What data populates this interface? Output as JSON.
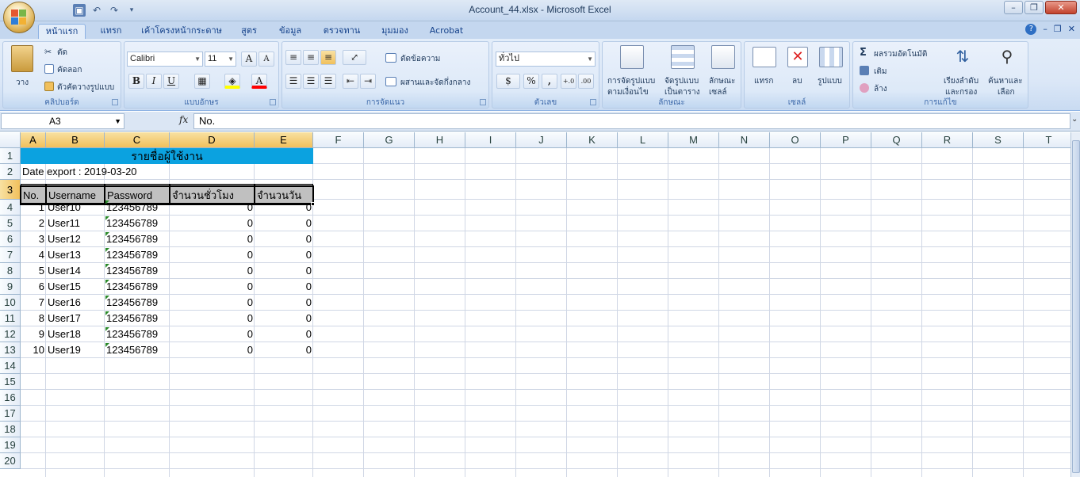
{
  "window": {
    "title": "Account_44.xlsx - Microsoft Excel",
    "min_label": "–",
    "max_label": "❐",
    "close_label": "✕"
  },
  "qat": {
    "save_icon": "save-icon",
    "undo_icon": "undo-icon",
    "redo_icon": "redo-icon"
  },
  "tabs": [
    {
      "label": "หน้าแรก",
      "active": true
    },
    {
      "label": "แทรก"
    },
    {
      "label": "เค้าโครงหน้ากระดาษ"
    },
    {
      "label": "สูตร"
    },
    {
      "label": "ข้อมูล"
    },
    {
      "label": "ตรวจทาน"
    },
    {
      "label": "มุมมอง"
    },
    {
      "label": "Acrobat"
    }
  ],
  "ribbon": {
    "clipboard": {
      "label": "คลิปบอร์ด",
      "paste": "วาง",
      "cut": "ตัด",
      "copy": "คัดลอก",
      "format_painter": "ตัวคัดวางรูปแบบ"
    },
    "font": {
      "label": "แบบอักษร",
      "font_name": "Calibri",
      "font_size": "11",
      "bold": "B",
      "italic": "I",
      "underline": "U"
    },
    "alignment": {
      "label": "การจัดแนว",
      "wrap_text": "ตัดข้อความ",
      "merge_center": "ผสานและจัดกึ่งกลาง"
    },
    "number": {
      "label": "ตัวเลข",
      "format": "ทั่วไป",
      "percent": "%",
      "comma": ","
    },
    "styles": {
      "label": "ลักษณะ",
      "conditional_1": "การจัดรูปแบบ",
      "conditional_2": "ตามเงื่อนไข",
      "table_1": "จัดรูปแบบ",
      "table_2": "เป็นตาราง",
      "cell_1": "ลักษณะ",
      "cell_2": "เซลล์"
    },
    "cells": {
      "label": "เซลล์",
      "insert": "แทรก",
      "delete": "ลบ",
      "format": "รูปแบบ"
    },
    "editing": {
      "label": "การแก้ไข",
      "autosum": "ผลรวมอัตโนมัติ",
      "fill": "เติม",
      "clear": "ล้าง",
      "sort_1": "เรียงลำดับ",
      "sort_2": "และกรอง",
      "find_1": "ค้นหาและ",
      "find_2": "เลือก"
    }
  },
  "formula_bar": {
    "name_box": "A3",
    "fx_label": "fx",
    "content": "No."
  },
  "columns": [
    "A",
    "B",
    "C",
    "D",
    "E",
    "F",
    "G",
    "H",
    "I",
    "J",
    "K",
    "L",
    "M",
    "N",
    "O",
    "P",
    "Q",
    "R",
    "S",
    "T"
  ],
  "rows": [
    "1",
    "2",
    "3",
    "4",
    "5",
    "6",
    "7",
    "8",
    "9",
    "10",
    "11",
    "12",
    "13",
    "14",
    "15",
    "16",
    "17",
    "18",
    "19",
    "20"
  ],
  "sheet": {
    "title": "รายชื่อผู้ใช้งาน",
    "export_line": "Date export : 2019-03-20",
    "headers": [
      "No.",
      "Username",
      "Password",
      "จำนวนชั่วโมง",
      "จำนวนวัน"
    ],
    "data": [
      [
        "1",
        "User10",
        "123456789",
        "0",
        "0"
      ],
      [
        "2",
        "User11",
        "123456789",
        "0",
        "0"
      ],
      [
        "3",
        "User12",
        "123456789",
        "0",
        "0"
      ],
      [
        "4",
        "User13",
        "123456789",
        "0",
        "0"
      ],
      [
        "5",
        "User14",
        "123456789",
        "0",
        "0"
      ],
      [
        "6",
        "User15",
        "123456789",
        "0",
        "0"
      ],
      [
        "7",
        "User16",
        "123456789",
        "0",
        "0"
      ],
      [
        "8",
        "User17",
        "123456789",
        "0",
        "0"
      ],
      [
        "9",
        "User18",
        "123456789",
        "0",
        "0"
      ],
      [
        "10",
        "User19",
        "123456789",
        "0",
        "0"
      ]
    ]
  },
  "colors": {
    "title_fill": "#0ba2e0",
    "header_fill": "#c0c0c0",
    "selection_header": "#f1c05c"
  }
}
